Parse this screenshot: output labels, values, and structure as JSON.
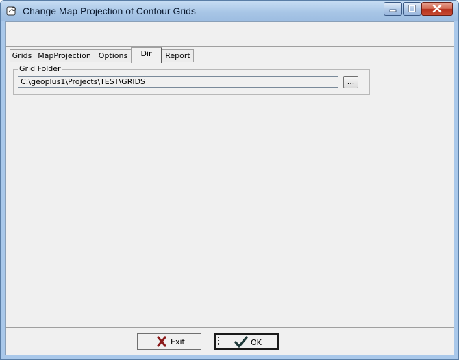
{
  "window": {
    "title": "Change Map Projection of Contour Grids"
  },
  "tabs": [
    {
      "label": "Grids"
    },
    {
      "label": "MapProjection"
    },
    {
      "label": "Options"
    },
    {
      "label": "Dir"
    },
    {
      "label": "Report"
    }
  ],
  "active_tab": "Dir",
  "dir_tab": {
    "group_label": "Grid Folder",
    "folder_path": "C:\\geoplus1\\Projects\\TEST\\GRIDS",
    "browse_label": "..."
  },
  "buttons": {
    "exit_label": "Exit",
    "ok_label": "OK"
  },
  "colors": {
    "exit_icon": "#8b1a1a",
    "ok_icon": "#1f3a3a",
    "titlebar": "#a9c8ea"
  },
  "icons": [
    "app-icon",
    "minimize-icon",
    "maximize-icon",
    "close-icon",
    "x-icon",
    "checkmark-icon"
  ]
}
